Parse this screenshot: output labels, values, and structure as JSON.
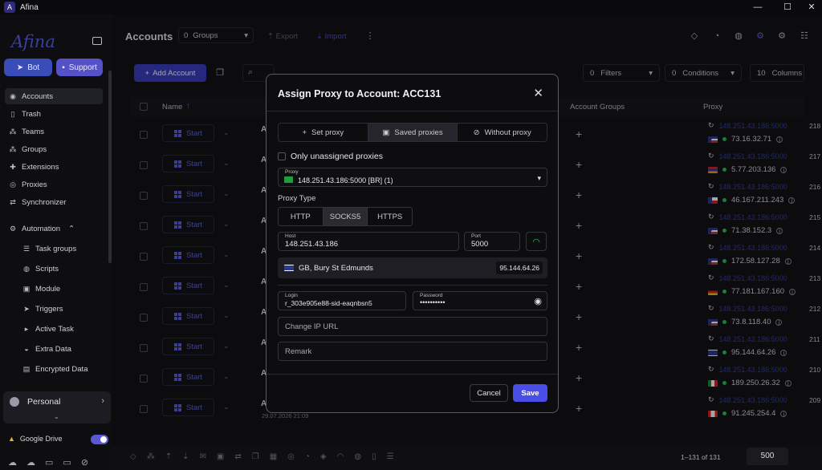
{
  "app": {
    "title": "Afina",
    "logo_letter": "A"
  },
  "window": {
    "minimize": "—",
    "maximize": "☐",
    "close": "✕"
  },
  "sidebar": {
    "brand": "Afina",
    "bot_label": "Bot",
    "support_label": "Support",
    "items": [
      {
        "label": "Accounts",
        "icon": "user-circle-icon"
      },
      {
        "label": "Trash",
        "icon": "trash-icon"
      },
      {
        "label": "Teams",
        "icon": "team-icon"
      },
      {
        "label": "Groups",
        "icon": "groups-icon"
      },
      {
        "label": "Extensions",
        "icon": "puzzle-icon"
      },
      {
        "label": "Proxies",
        "icon": "proxy-icon"
      },
      {
        "label": "Synchronizer",
        "icon": "sync-icon"
      }
    ],
    "automation_label": "Automation",
    "automation_items": [
      {
        "label": "Task groups"
      },
      {
        "label": "Scripts"
      },
      {
        "label": "Module"
      },
      {
        "label": "Triggers"
      },
      {
        "label": "Active Task"
      },
      {
        "label": "Extra Data"
      },
      {
        "label": "Encrypted Data"
      }
    ],
    "personal_label": "Personal",
    "gdrive_label": "Google Drive"
  },
  "header": {
    "title": "Accounts",
    "groups_count": "0",
    "groups_label": "Groups",
    "export_label": "Export",
    "import_label": "Import",
    "add_account_label": "Add Account",
    "filters_count": "0",
    "filters_label": "Filters",
    "conditions_count": "0",
    "conditions_label": "Conditions",
    "columns_count": "10",
    "columns_label": "Columns"
  },
  "table": {
    "col_name": "Name",
    "col_groups": "Account Groups",
    "col_proxy": "Proxy",
    "start_label": "Start",
    "last_date": "29.07.2026 21:09",
    "rows": [
      {
        "proxy": "148.251.43.186:5000",
        "num": "218",
        "ip": "73.16.32.71",
        "flag": "us"
      },
      {
        "proxy": "148.251.43.186:5000",
        "num": "217",
        "ip": "5.77.203.136",
        "flag": "am"
      },
      {
        "proxy": "148.251.43.186:5000",
        "num": "216",
        "ip": "46.167.211.243",
        "flag": "cz"
      },
      {
        "proxy": "148.251.43.186:5000",
        "num": "215",
        "ip": "71.38.152.3",
        "flag": "us"
      },
      {
        "proxy": "148.251.43.186:5000",
        "num": "214",
        "ip": "172.58.127.28",
        "flag": "us"
      },
      {
        "proxy": "148.251.43.186:5000",
        "num": "213",
        "ip": "77.181.167.160",
        "flag": "de"
      },
      {
        "proxy": "148.251.43.186:5000",
        "num": "212",
        "ip": "73.8.118.40",
        "flag": "us"
      },
      {
        "proxy": "148.251.43.186:5000",
        "num": "211",
        "ip": "95.144.64.26",
        "flag": "gb"
      },
      {
        "proxy": "148.251.43.186:5000",
        "num": "210",
        "ip": "189.250.26.32",
        "flag": "mx"
      },
      {
        "proxy": "148.251.43.186:5000",
        "num": "209",
        "ip": "91.245.254.4",
        "flag": "ca"
      }
    ],
    "pagination": "1–131 of 131",
    "page_size": "500"
  },
  "modal": {
    "title": "Assign Proxy to Account: ACC131",
    "tabs": [
      {
        "label": "Set proxy",
        "icon": "plus-icon"
      },
      {
        "label": "Saved proxies",
        "icon": "save-icon"
      },
      {
        "label": "Without proxy",
        "icon": "ban-icon"
      }
    ],
    "only_unassigned": "Only unassigned proxies",
    "proxy_label": "Proxy",
    "proxy_value": "148.251.43.186:5000  [BR] (1)",
    "proxy_type_label": "Proxy Type",
    "types": [
      "HTTP",
      "SOCKS5",
      "HTTPS"
    ],
    "host_label": "Host",
    "host_value": "148.251.43.186",
    "port_label": "Port",
    "port_value": "5000",
    "geo_text": "GB, Bury St Edmunds",
    "geo_ip": "95.144.64.26",
    "login_label": "Login",
    "login_value": "r_303e905e88-sid-eaqnbsn5",
    "password_label": "Password",
    "password_value": "••••••••••",
    "change_ip_placeholder": "Change IP URL",
    "remark_placeholder": "Remark",
    "cancel_label": "Cancel",
    "save_label": "Save"
  },
  "colors": {
    "accent": "#4b4ee6",
    "green": "#2fbf5d",
    "link": "#3a3e9e"
  }
}
